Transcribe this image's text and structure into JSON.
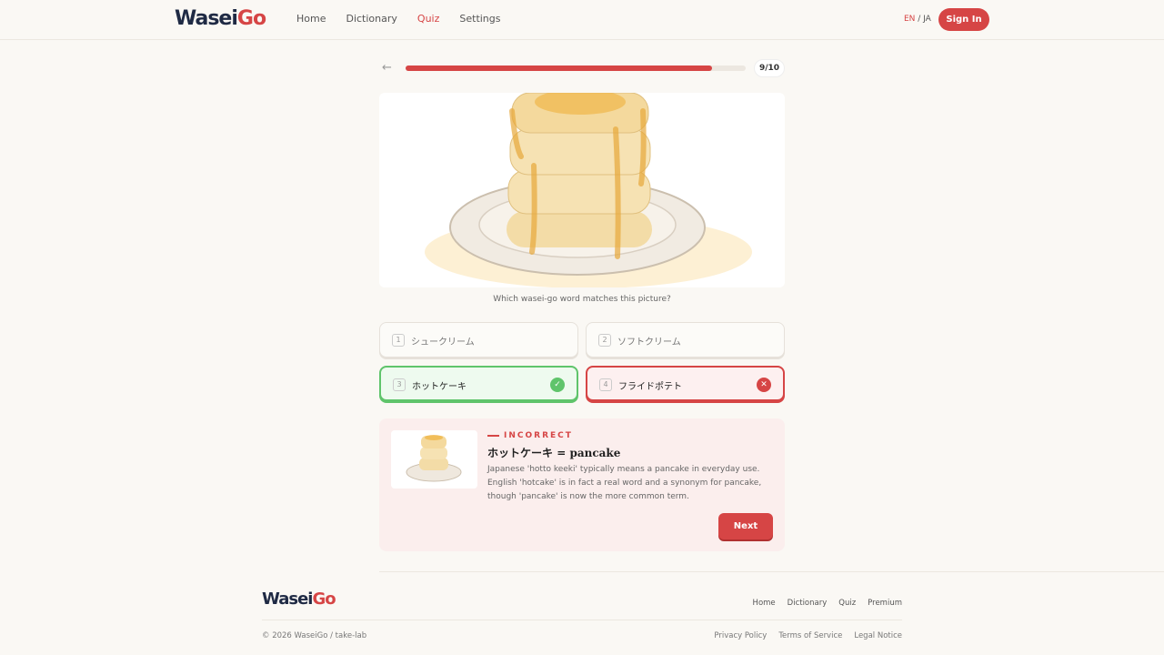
{
  "header": {
    "logo_main": "Wasei",
    "logo_accent": "Go",
    "nav": [
      "Home",
      "Dictionary",
      "Quiz",
      "Settings"
    ],
    "active_nav": "Quiz",
    "lang_current": "EN",
    "lang_sep": " / ",
    "lang_other": "JA",
    "signin_label": "Sign In"
  },
  "progress": {
    "fraction": 0.9,
    "counter": "9/10"
  },
  "quiz": {
    "question": "Which wasei-go word matches this picture?",
    "options": [
      {
        "num": "1",
        "label": "シュークリーム",
        "state": "neutral"
      },
      {
        "num": "2",
        "label": "ソフトクリーム",
        "state": "neutral"
      },
      {
        "num": "3",
        "label": "ホットケーキ",
        "state": "correct",
        "mark": "✓"
      },
      {
        "num": "4",
        "label": "フライドポテト",
        "state": "wrong",
        "mark": "✕"
      }
    ]
  },
  "feedback": {
    "status": "INCORRECT",
    "word": "ホットケーキ",
    "equals": " = ",
    "meaning": "pancake",
    "description": "Japanese 'hotto keeki' typically means a pancake in everyday use. English 'hotcake' is in fact a real word and a synonym for pancake, though 'pancake' is now the more common term.",
    "next_label": "Next"
  },
  "footer": {
    "logo_main": "Wasei",
    "logo_accent": "Go",
    "nav": [
      "Home",
      "Dictionary",
      "Quiz",
      "Premium"
    ],
    "copyright": "© 2026 WaseiGo / take-lab",
    "legal": [
      "Privacy Policy",
      "Terms of Service",
      "Legal Notice"
    ]
  },
  "colors": {
    "accent": "#d64545",
    "correct": "#5fc46b",
    "brand_dark": "#1f2a44"
  }
}
